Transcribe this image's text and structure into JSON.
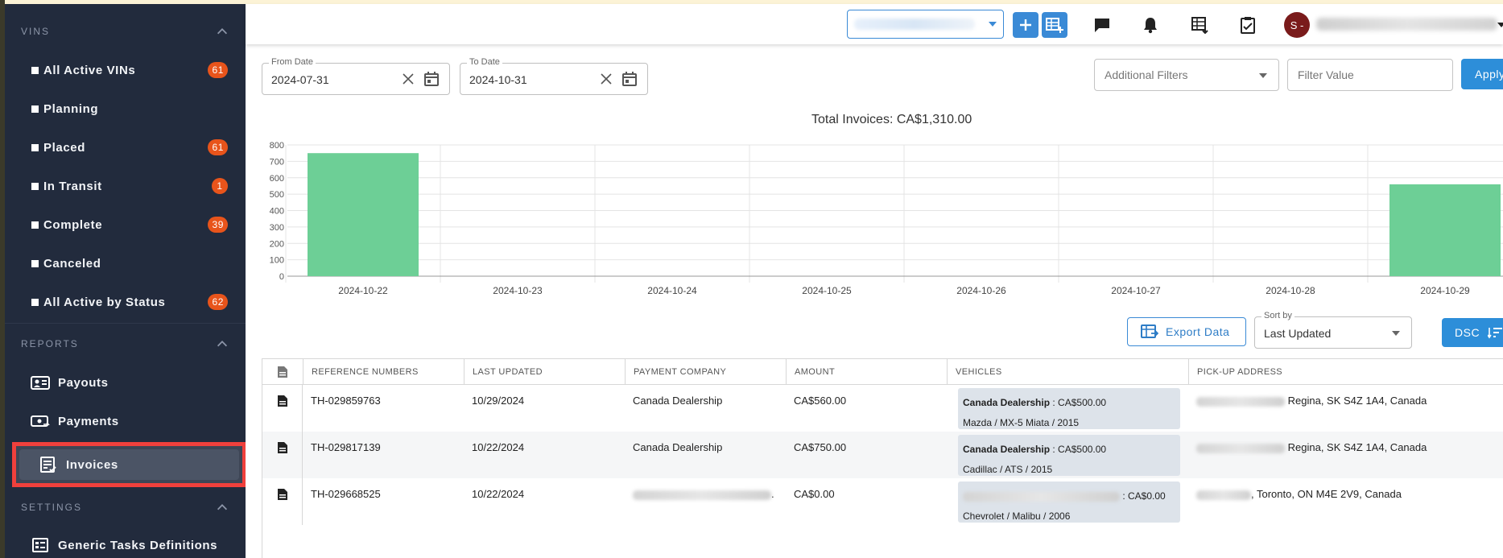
{
  "sidebar": {
    "vins_heading": "VINS",
    "vins_items": [
      {
        "label": "All Active VINs",
        "badge": "61"
      },
      {
        "label": "Planning",
        "badge": ""
      },
      {
        "label": "Placed",
        "badge": "61"
      },
      {
        "label": "In Transit",
        "badge": "1"
      },
      {
        "label": "Complete",
        "badge": "39"
      },
      {
        "label": "Canceled",
        "badge": ""
      },
      {
        "label": "All Active by Status",
        "badge": "62"
      }
    ],
    "reports_heading": "REPORTS",
    "reports_items": [
      {
        "label": "Payouts",
        "icon": "payouts-icon"
      },
      {
        "label": "Payments",
        "icon": "payments-icon"
      },
      {
        "label": "Invoices",
        "icon": "invoices-icon",
        "active": true
      }
    ],
    "settings_heading": "SETTINGS",
    "settings_items": [
      {
        "label": "Generic Tasks Definitions",
        "icon": "task-definitions-icon"
      }
    ]
  },
  "header": {
    "avatar_initial": "S -",
    "accent_color": "#3a8ad6"
  },
  "filters": {
    "from_date_label": "From Date",
    "from_date_value": "2024-07-31",
    "to_date_label": "To Date",
    "to_date_value": "2024-10-31",
    "additional_filters_placeholder": "Additional Filters",
    "filter_value_placeholder": "Filter Value",
    "apply_label": "Apply"
  },
  "chart_title": "Total Invoices: CA$1,310.00",
  "chart_data": {
    "type": "bar",
    "title": "Total Invoices: CA$1,310.00",
    "categories": [
      "2024-10-22",
      "2024-10-23",
      "2024-10-24",
      "2024-10-25",
      "2024-10-26",
      "2024-10-27",
      "2024-10-28",
      "2024-10-29"
    ],
    "values": [
      750,
      0,
      0,
      0,
      0,
      0,
      0,
      560
    ],
    "y_ticks": [
      "0",
      "100",
      "200",
      "300",
      "400",
      "500",
      "600",
      "700",
      "800"
    ],
    "ylim": [
      0,
      800
    ],
    "bar_color": "#6dcf96",
    "grid": true
  },
  "toolbar": {
    "export_label": "Export Data",
    "sort_label": "Sort by",
    "sort_value": "Last Updated",
    "order_label": "DSC"
  },
  "table": {
    "headers": [
      "REFERENCE NUMBERS",
      "LAST UPDATED",
      "PAYMENT COMPANY",
      "AMOUNT",
      "VEHICLES",
      "PICK-UP ADDRESS"
    ],
    "rows": [
      {
        "ref": "TH-029859763",
        "updated": "10/29/2024",
        "company": "Canada Dealership",
        "amount": "CA$560.00",
        "veh_company": "Canada Dealership",
        "veh_amount": " : CA$500.00",
        "vehicle": "Mazda / MX-5 Miata / 2015",
        "address": "Regina, SK S4Z 1A4, Canada"
      },
      {
        "ref": "TH-029817139",
        "updated": "10/22/2024",
        "company": "Canada Dealership",
        "amount": "CA$750.00",
        "veh_company": "Canada Dealership",
        "veh_amount": " : CA$500.00",
        "vehicle": "Cadillac / ATS / 2015",
        "address": "Regina, SK S4Z 1A4, Canada"
      },
      {
        "ref": "TH-029668525",
        "updated": "10/22/2024",
        "company": ".",
        "amount": "CA$0.00",
        "veh_company": "",
        "veh_amount": " : CA$0.00",
        "vehicle": "Chevrolet / Malibu / 2006",
        "address": ", Toronto, ON M4E 2V9, Canada"
      }
    ]
  }
}
